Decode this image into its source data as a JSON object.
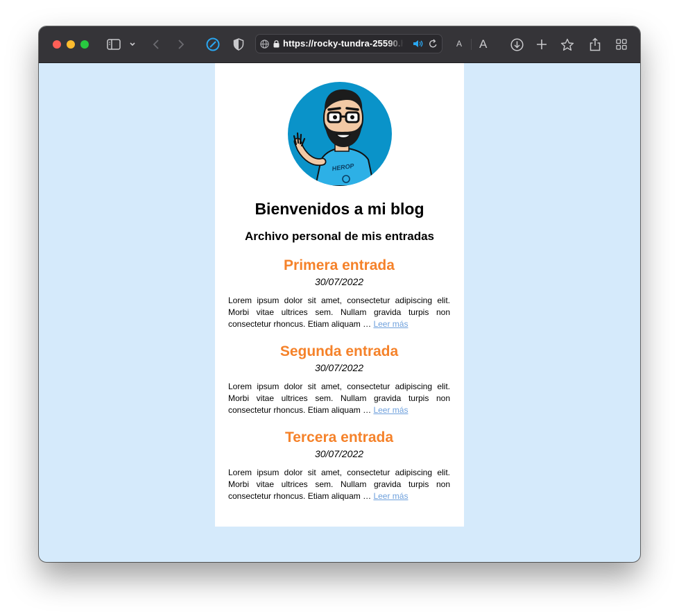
{
  "browser": {
    "url": "https://rocky-tundra-25590.h",
    "reader_small_a": "A",
    "reader_large_a": "A"
  },
  "blog": {
    "title": "Bienvenidos a mi blog",
    "subtitle": "Archivo personal de mis entradas",
    "avatar_shirt_text": "HEROP",
    "posts": [
      {
        "title": "Primera entrada",
        "date": "30/07/2022",
        "excerpt": "Lorem ipsum dolor sit amet, consectetur adipiscing elit. Morbi vitae ultrices sem. Nullam gravida turpis non consectetur rhoncus. Etiam aliquam …",
        "link": "Leer más"
      },
      {
        "title": "Segunda entrada",
        "date": "30/07/2022",
        "excerpt": "Lorem ipsum dolor sit amet, consectetur adipiscing elit. Morbi vitae ultrices sem. Nullam gravida turpis non consectetur rhoncus. Etiam aliquam …",
        "link": "Leer más"
      },
      {
        "title": "Tercera entrada",
        "date": "30/07/2022",
        "excerpt": "Lorem ipsum dolor sit amet, consectetur adipiscing elit. Morbi vitae ultrices sem. Nullam gravida turpis non consectetur rhoncus. Etiam aliquam …",
        "link": "Leer más"
      }
    ]
  },
  "colors": {
    "page_background": "#d5eafb",
    "post_title": "#f5822a",
    "link": "#6ea0dc",
    "avatar_background": "#0a93c9"
  },
  "icons": [
    "sidebar-icon",
    "chevron-down-icon",
    "back-icon",
    "forward-icon",
    "extension-icon",
    "shield-icon",
    "globe-icon",
    "lock-icon",
    "speaker-icon",
    "reload-icon",
    "download-icon",
    "plus-icon",
    "star-icon",
    "share-icon",
    "tab-overview-icon"
  ]
}
